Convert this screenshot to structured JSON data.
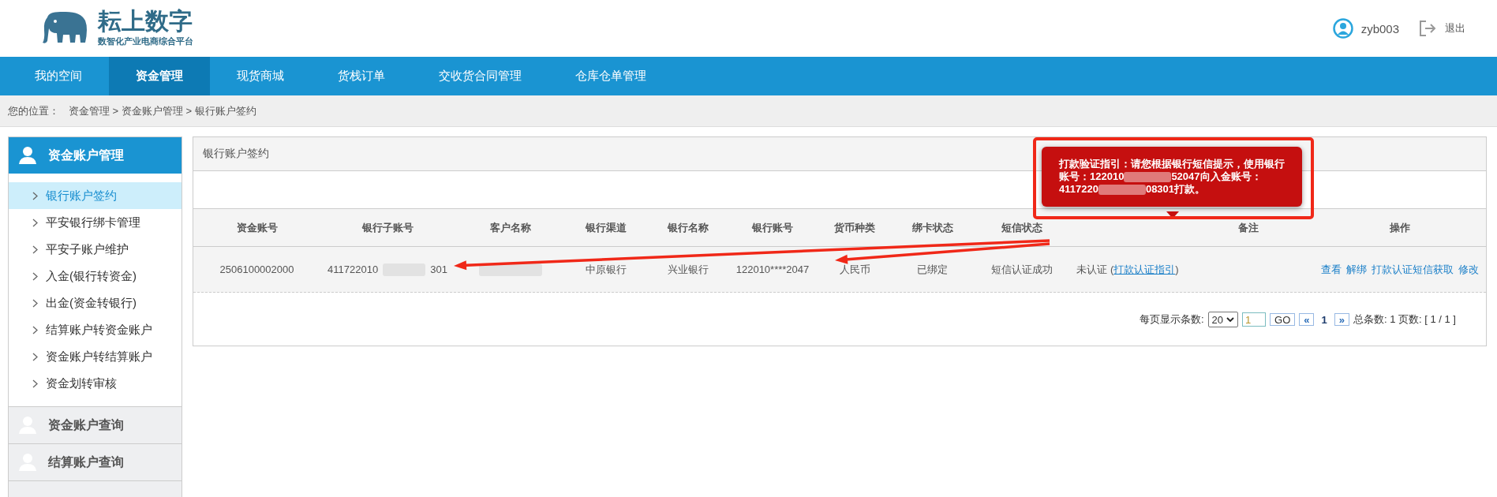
{
  "header": {
    "logo_title": "耘上数字",
    "logo_subtitle": "数智化产业电商综合平台",
    "username": "zyb003",
    "logout": "退出"
  },
  "nav": [
    {
      "label": "我的空间",
      "selected": false
    },
    {
      "label": "资金管理",
      "selected": true
    },
    {
      "label": "现货商城",
      "selected": false
    },
    {
      "label": "货栈订单",
      "selected": false
    },
    {
      "label": "交收货合同管理",
      "selected": false
    },
    {
      "label": "仓库仓单管理",
      "selected": false
    }
  ],
  "breadcrumb": {
    "label": "您的位置：",
    "path": "资金管理 > 资金账户管理 > 银行账户签约"
  },
  "sidebar": {
    "groups": [
      {
        "title": "资金账户管理",
        "expanded": true,
        "items": [
          {
            "label": "银行账户签约",
            "selected": true
          },
          {
            "label": "平安银行绑卡管理",
            "selected": false
          },
          {
            "label": "平安子账户维护",
            "selected": false
          },
          {
            "label": "入金(银行转资金)",
            "selected": false
          },
          {
            "label": "出金(资金转银行)",
            "selected": false
          },
          {
            "label": "结算账户转资金账户",
            "selected": false
          },
          {
            "label": "资金账户转结算账户",
            "selected": false
          },
          {
            "label": "资金划转审核",
            "selected": false
          }
        ]
      },
      {
        "title": "资金账户查询",
        "expanded": false
      },
      {
        "title": "结算账户查询",
        "expanded": false
      }
    ]
  },
  "panel": {
    "title": "银行账户签约",
    "table": {
      "columns": [
        {
          "label": "资金账号"
        },
        {
          "label": "银行子账号"
        },
        {
          "label": "客户名称"
        },
        {
          "label": "银行渠道"
        },
        {
          "label": "银行名称"
        },
        {
          "label": "银行账号"
        },
        {
          "label": "货币种类"
        },
        {
          "label": "绑卡状态"
        },
        {
          "label": "短信状态"
        },
        {},
        {
          "label": "备注"
        },
        {
          "label": "操作"
        }
      ],
      "rows": [
        {
          "cells": [
            {
              "kind": "text",
              "text": "2506100002000"
            },
            {
              "kind": "masked",
              "prefix": "411722010",
              "suffix": "301"
            },
            {
              "kind": "blurred"
            },
            {
              "kind": "text",
              "text": "中原银行"
            },
            {
              "kind": "text",
              "text": "兴业银行"
            },
            {
              "kind": "text",
              "text": "122010****2047"
            },
            {
              "kind": "text",
              "text": "人民币"
            },
            {
              "kind": "text",
              "text": "已绑定"
            },
            {
              "kind": "text",
              "text": "短信认证成功"
            },
            {
              "kind": "status_link",
              "text": "未认证 (",
              "link": "打款认证指引",
              "after": ")"
            },
            {
              "kind": "empty"
            },
            {
              "kind": "links",
              "links": [
                "查看",
                "解绑",
                "打款认证短信获取",
                "修改"
              ]
            }
          ]
        }
      ]
    },
    "pagination": {
      "per_page_label": "每页显示条数:",
      "per_page": "20",
      "page_input": "1",
      "go": "GO",
      "prev": "«",
      "current": "1",
      "next": "»",
      "summary": "总条数: 1 页数: [ 1 / 1 ]"
    }
  },
  "tooltip": {
    "segments": [
      "打款验证指引：请您根据银行短信提示，使用银行账号：122010",
      "52047向入金账号：4117220",
      "08301打款。"
    ]
  },
  "annotations": [
    {
      "kind": "box"
    },
    {
      "kind": "arrow"
    },
    {
      "kind": "arrow"
    }
  ]
}
